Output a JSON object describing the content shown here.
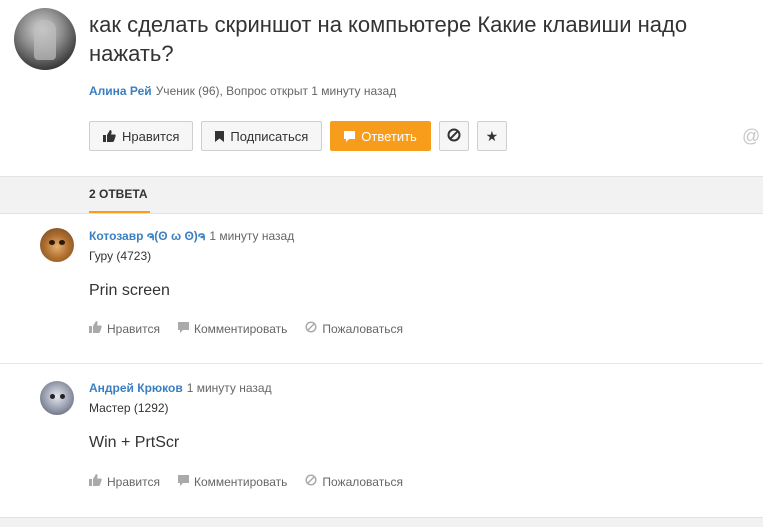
{
  "question": {
    "title": "как сделать скриншот на компьютере Какие клавиши надо нажать?",
    "author": "Алина Рей",
    "meta": "Ученик (96), Вопрос открыт 1 минуту назад"
  },
  "actions": {
    "like": "Нравится",
    "subscribe": "Подписаться",
    "answer": "Ответить"
  },
  "answers_tab": "2 ОТВЕТА",
  "answers": [
    {
      "name": "Котозавр ຈ(ʘ ω ʘ)ຈ",
      "time": "1 минуту назад",
      "rank": "Гуру (4723)",
      "text": "Prin screen",
      "like": "Нравится",
      "comment": "Комментировать",
      "report": "Пожаловаться"
    },
    {
      "name": "Андрей Крюков",
      "time": "1 минуту назад",
      "rank": "Мастер (1292)",
      "text": "Win + PrtScr",
      "like": "Нравится",
      "comment": "Комментировать",
      "report": "Пожаловаться"
    }
  ],
  "colors": {
    "accent": "#f89c1c",
    "link": "#3a7fc1"
  }
}
